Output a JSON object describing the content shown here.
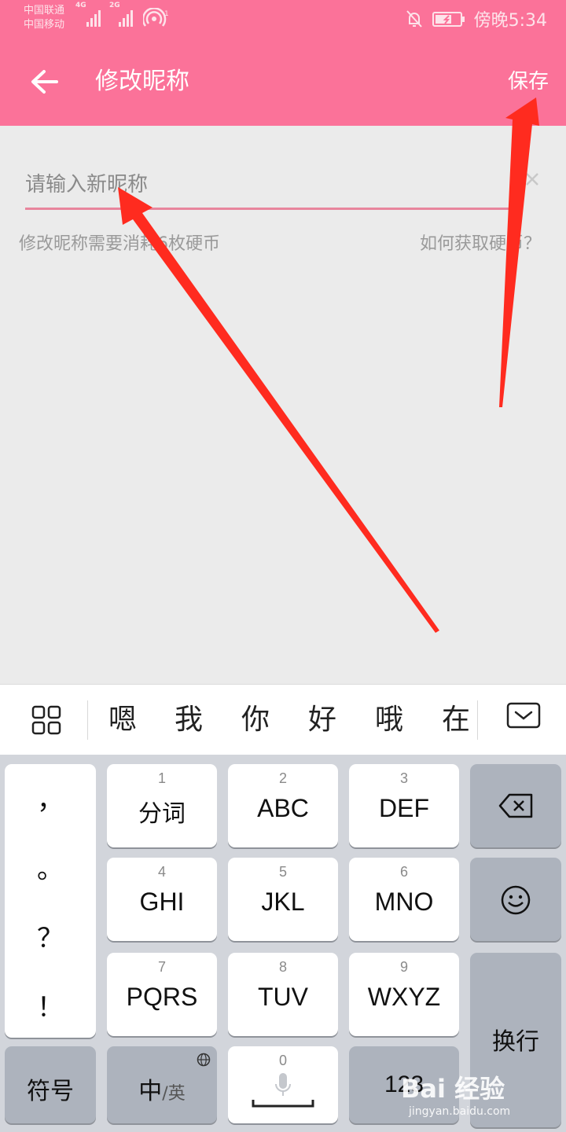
{
  "status_bar": {
    "carrier_1": "中国联通",
    "carrier_2": "中国移动",
    "net_1": "4G",
    "net_2": "2G",
    "time": "傍晚5:34"
  },
  "app_bar": {
    "title": "修改昵称",
    "save_label": "保存"
  },
  "nickname_form": {
    "placeholder": "请输入新昵称",
    "value": "",
    "cost_hint": "修改昵称需要消耗6枚硬币",
    "help_link": "如何获取硬币？"
  },
  "candidate_bar": {
    "candidates": [
      "嗯",
      "我",
      "你",
      "好",
      "哦",
      "在"
    ]
  },
  "keyboard": {
    "punctuation": [
      "，",
      "。",
      "？",
      "！"
    ],
    "keys": [
      {
        "num": "1",
        "label": "分词"
      },
      {
        "num": "2",
        "label": "ABC"
      },
      {
        "num": "3",
        "label": "DEF"
      },
      {
        "num": "4",
        "label": "GHI"
      },
      {
        "num": "5",
        "label": "JKL"
      },
      {
        "num": "6",
        "label": "MNO"
      },
      {
        "num": "7",
        "label": "PQRS"
      },
      {
        "num": "8",
        "label": "TUV"
      },
      {
        "num": "9",
        "label": "WXYZ"
      }
    ],
    "symbols_label": "符号",
    "lang_main": "中",
    "lang_sub": "/英",
    "space_num": "0",
    "numeric_label": "123",
    "enter_label": "换行"
  },
  "watermark": {
    "brand": "Bai 经验",
    "url": "jingyan.baidu.com"
  },
  "colors": {
    "brand_pink": "#fb7299",
    "annotation_red": "#ff2b1f"
  }
}
